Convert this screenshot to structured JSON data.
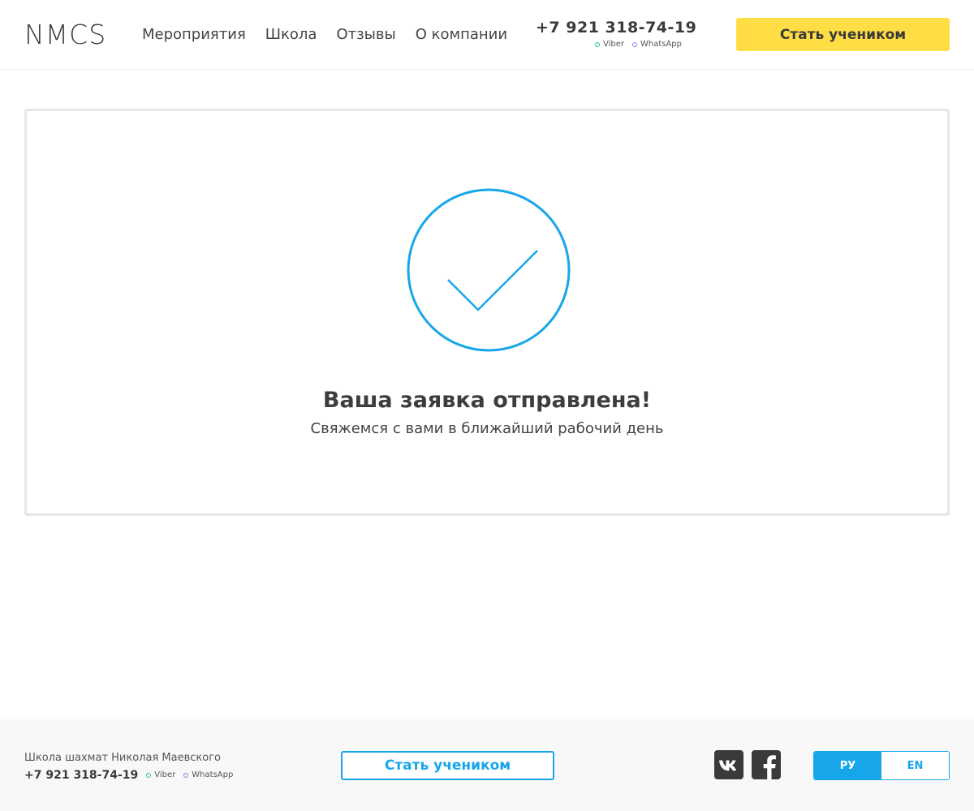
{
  "header": {
    "logo": "NMCS",
    "nav": [
      {
        "label": "Мероприятия"
      },
      {
        "label": "Школа"
      },
      {
        "label": "Отзывы"
      },
      {
        "label": "О компании"
      }
    ],
    "phone": "+7 921 318-74-19",
    "messengers": {
      "viber": "Viber",
      "whatsapp": "WhatsApp"
    },
    "cta_label": "Стать учеником"
  },
  "success": {
    "title": "Ваша заявка отправлена!",
    "subtitle": "Свяжемся с вами в ближайший рабочий день"
  },
  "footer": {
    "school_name": "Школа шахмат Николая Маевского",
    "phone": "+7 921 318-74-19",
    "messengers": {
      "viber": "Viber",
      "whatsapp": "WhatsApp"
    },
    "cta_label": "Стать учеником",
    "social": [
      "vk-icon",
      "facebook-icon"
    ],
    "languages": [
      {
        "label": "РУ",
        "active": true
      },
      {
        "label": "EN",
        "active": false
      }
    ]
  },
  "colors": {
    "accent_yellow": "#ffdd44",
    "accent_blue": "#18a6ea",
    "viber_dot": "#2bc48a",
    "whatsapp_dot": "#8e7fe0",
    "text": "#3a3a3a"
  }
}
